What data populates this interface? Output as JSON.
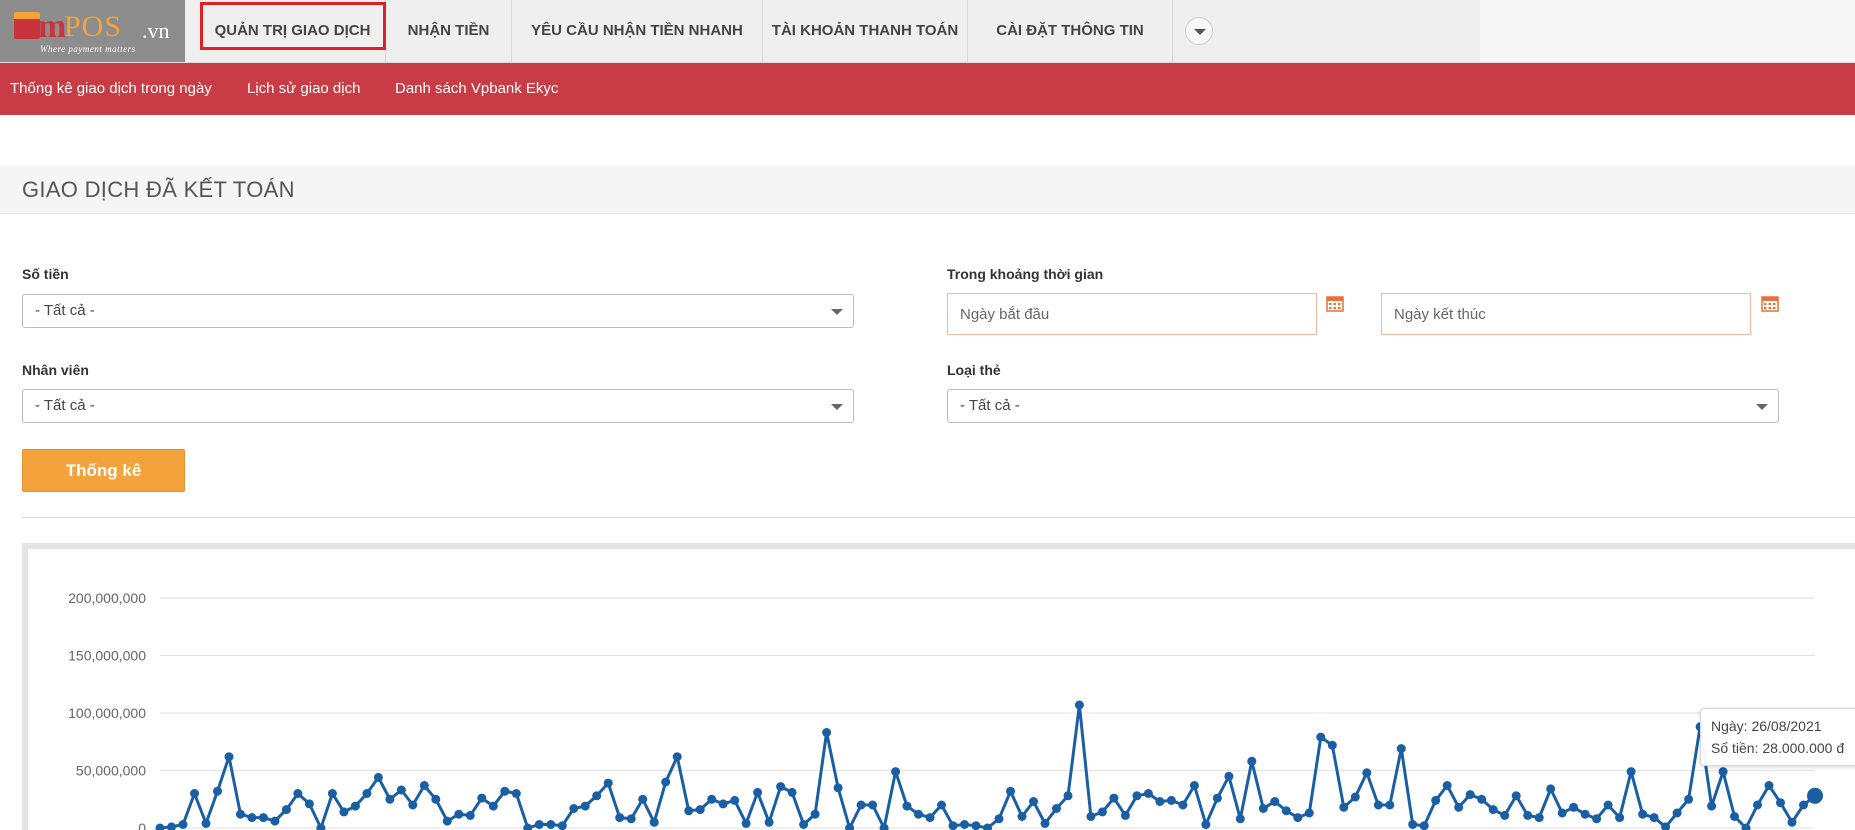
{
  "logo": {
    "m": "m",
    "pos": "POS",
    "vn": ".vn",
    "tagline": "Where payment matters"
  },
  "nav": {
    "items": [
      {
        "label": "QUẢN TRỊ GIAO DỊCH",
        "active": true
      },
      {
        "label": "NHẬN TIỀN"
      },
      {
        "label": "YÊU CẦU NHẬN TIỀN NHANH"
      },
      {
        "label": "TÀI KHOẢN THANH TOÁN"
      },
      {
        "label": "CÀI ĐẶT THÔNG TIN"
      }
    ],
    "more_icon": "chevron-down-icon",
    "active_highlight_color": "#e12024"
  },
  "subnav": {
    "items": [
      {
        "label": "Thống kê giao dịch trong ngày"
      },
      {
        "label": "Lịch sử giao dịch"
      },
      {
        "label": "Danh sách Vpbank Ekyc"
      }
    ],
    "background": "#c93c45"
  },
  "section": {
    "title": "GIAO DỊCH ĐÃ KẾT TOÁN"
  },
  "filters": {
    "amount": {
      "label": "Số tiền",
      "value": "- Tất cả -"
    },
    "employee": {
      "label": "Nhân viên",
      "value": "- Tất cả -"
    },
    "period": {
      "label": "Trong khoảng thời gian",
      "start_placeholder": "Ngày bắt đầu",
      "end_placeholder": "Ngày kết thúc",
      "calendar_icon": "calendar-icon"
    },
    "card_type": {
      "label": "Loại thẻ",
      "value": "- Tất cả -"
    },
    "submit_label": "Thống kê",
    "submit_color": "#f4a23c"
  },
  "chart_data": {
    "type": "line",
    "ylim": [
      0,
      200000000
    ],
    "yticks": [
      "0",
      "50,000,000",
      "100,000,000",
      "150,000,000",
      "200,000,000"
    ],
    "grid": true,
    "series": [
      {
        "color": "#1a5fa4",
        "values": [
          0,
          1000000,
          3000000,
          30000000,
          4000000,
          32000000,
          62000000,
          12000000,
          9000000,
          9000000,
          6000000,
          16000000,
          30000000,
          21000000,
          0,
          30000000,
          14000000,
          19000000,
          30000000,
          44000000,
          25000000,
          33000000,
          20000000,
          37000000,
          25000000,
          6000000,
          12000000,
          11000000,
          26000000,
          19000000,
          32000000,
          30000000,
          0,
          3000000,
          3000000,
          2000000,
          17000000,
          19000000,
          28000000,
          39000000,
          9000000,
          8000000,
          25000000,
          5000000,
          40000000,
          62000000,
          15000000,
          16000000,
          25000000,
          21000000,
          24000000,
          4000000,
          31000000,
          5000000,
          36000000,
          31000000,
          3000000,
          12000000,
          83000000,
          35000000,
          0,
          20000000,
          20000000,
          0,
          49000000,
          19000000,
          12000000,
          9000000,
          20000000,
          2000000,
          3000000,
          2000000,
          0,
          8000000,
          32000000,
          10000000,
          23000000,
          4000000,
          17000000,
          28000000,
          107000000,
          10000000,
          14000000,
          26000000,
          11000000,
          28000000,
          30000000,
          23000000,
          24000000,
          20000000,
          37000000,
          3000000,
          26000000,
          45000000,
          8000000,
          58000000,
          17000000,
          23000000,
          15000000,
          9000000,
          13000000,
          79000000,
          72000000,
          18000000,
          27000000,
          48000000,
          20000000,
          20000000,
          69000000,
          3000000,
          2000000,
          24000000,
          37000000,
          18000000,
          29000000,
          25000000,
          16000000,
          11000000,
          28000000,
          11000000,
          9000000,
          34000000,
          13000000,
          18000000,
          12000000,
          8000000,
          20000000,
          9000000,
          49000000,
          12000000,
          9000000,
          1000000,
          13000000,
          25000000,
          88000000,
          19000000,
          49000000,
          10000000,
          0,
          20000000,
          37000000,
          22000000,
          5000000,
          20000000,
          28000000
        ]
      }
    ],
    "tooltip": {
      "date": "Ngày: 26/08/2021",
      "amount": "Số tiền: 28.000.000 đ"
    }
  }
}
